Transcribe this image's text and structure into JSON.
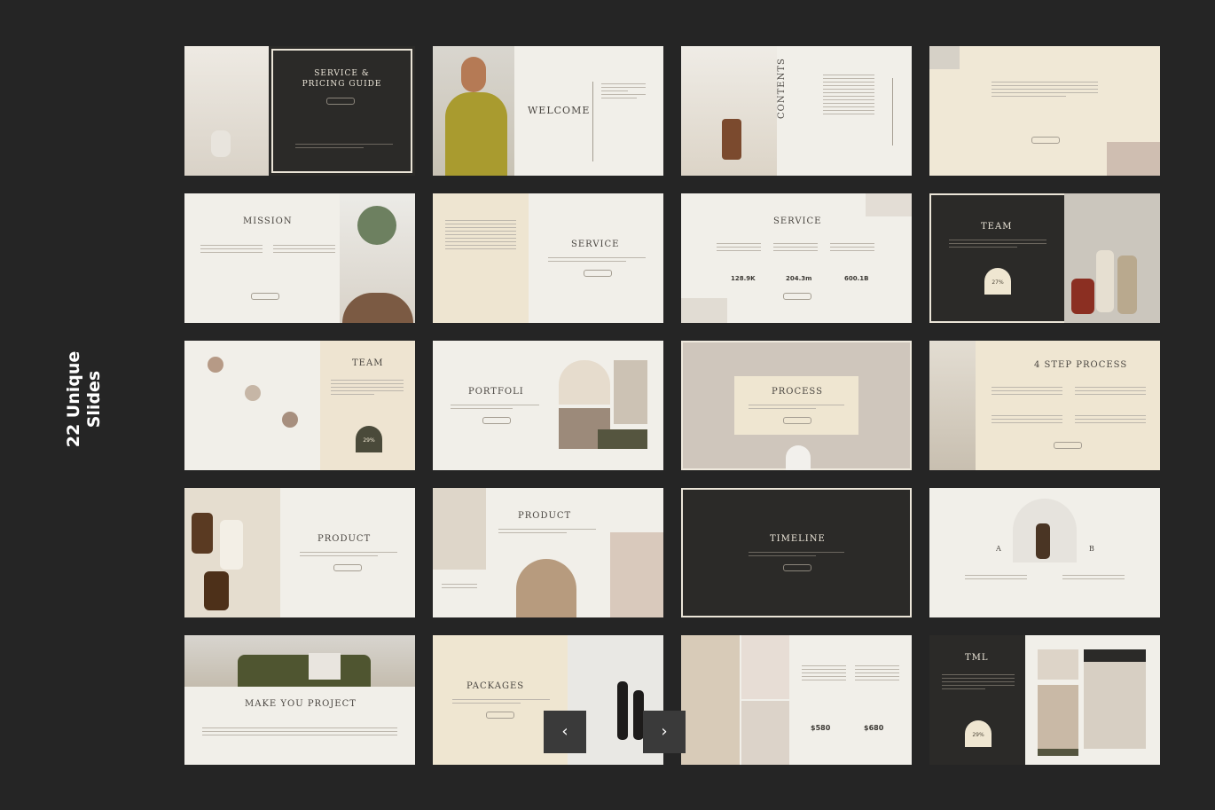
{
  "side_title": [
    "22 Unique",
    "Slides"
  ],
  "nav": {
    "prev_icon": "‹",
    "next_icon": "›"
  },
  "slides": [
    {
      "title": "SERVICE &",
      "title2": "PRICING GUIDE"
    },
    {
      "title": "WELCOME"
    },
    {
      "title": "CONTENTS"
    },
    {
      "title": ""
    },
    {
      "title": "MISSION"
    },
    {
      "title": "SERVICE"
    },
    {
      "title": "SERVICE",
      "stats": [
        "128.9K",
        "204.3m",
        "600.1B"
      ]
    },
    {
      "title": "TEAM",
      "badge": "27%"
    },
    {
      "title": "TEAM",
      "badge": "29%"
    },
    {
      "title": "PORTFOLI"
    },
    {
      "title": "PROCESS"
    },
    {
      "title": "4 STEP PROCESS"
    },
    {
      "title": "PRODUCT"
    },
    {
      "title": "PRODUCT"
    },
    {
      "title": "TIMELINE"
    },
    {
      "title": "",
      "labels": [
        "A",
        "B"
      ]
    },
    {
      "title": "MAKE YOU PROJECT"
    },
    {
      "title": "PACKAGES"
    },
    {
      "title": "",
      "prices": [
        "$580",
        "$680"
      ]
    },
    {
      "title": "TML",
      "badge": "29%"
    }
  ],
  "colors": {
    "background": "#252525",
    "slide_light": "#f1efe9",
    "slide_dark": "#2b2a28",
    "accent_olive": "#55553f"
  }
}
